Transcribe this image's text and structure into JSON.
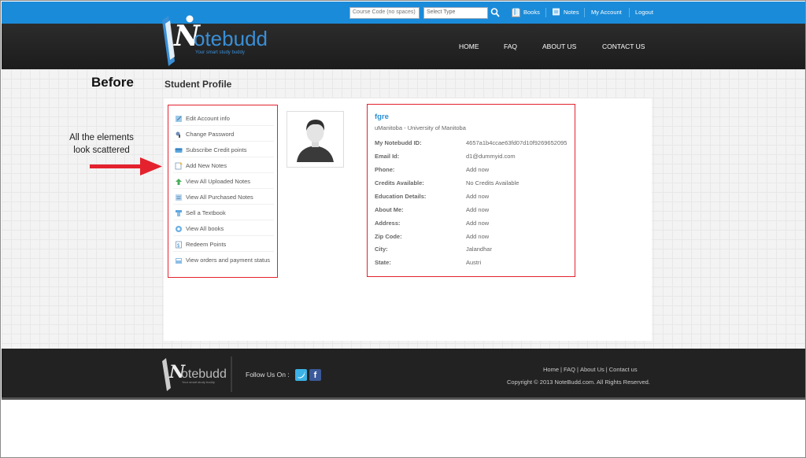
{
  "topbar": {
    "course_placeholder": "Course Code (no spaces)",
    "select_type": "Select Type",
    "links": [
      "Books",
      "Notes",
      "My Account",
      "Logout"
    ]
  },
  "header": {
    "logo_text": "Notebudd",
    "logo_tagline": "Your smart study buddy",
    "nav": [
      "HOME",
      "FAQ",
      "ABOUT US",
      "CONTACT US"
    ]
  },
  "annotation": {
    "before": "Before",
    "note": "All the elements look scattered"
  },
  "page": {
    "title": "Student Profile"
  },
  "menu": {
    "items": [
      {
        "label": "Edit Account info",
        "icon": "edit-icon"
      },
      {
        "label": "Change Password",
        "icon": "key-icon"
      },
      {
        "label": "Subscribe Credit points",
        "icon": "credit-icon"
      },
      {
        "label": "Add New Notes",
        "icon": "add-note-icon"
      },
      {
        "label": "View All Uploaded Notes",
        "icon": "upload-icon"
      },
      {
        "label": "View All Purchased Notes",
        "icon": "purchase-icon"
      },
      {
        "label": "Sell a Textbook",
        "icon": "sell-icon"
      },
      {
        "label": "View All books",
        "icon": "books-icon"
      },
      {
        "label": "Redeem Points",
        "icon": "redeem-icon"
      },
      {
        "label": "View orders and payment status",
        "icon": "orders-icon"
      }
    ]
  },
  "profile": {
    "name": "fgre",
    "university": "uManitoba - University of Manitoba",
    "fields": [
      {
        "key": "My Notebudd ID:",
        "value": "4657a1b4ccae63fd07d10f9269652095"
      },
      {
        "key": "Email Id:",
        "value": "d1@dummyid.com"
      },
      {
        "key": "Phone:",
        "value": "Add now"
      },
      {
        "key": "Credits Available:",
        "value": "No Credits Available"
      },
      {
        "key": "Education Details:",
        "value": "Add now"
      },
      {
        "key": "About Me:",
        "value": "Add now"
      },
      {
        "key": "Address:",
        "value": "Add now"
      },
      {
        "key": "Zip Code:",
        "value": "Add now"
      },
      {
        "key": "City:",
        "value": "Jalandhar"
      },
      {
        "key": "State:",
        "value": "Austri"
      }
    ]
  },
  "footer": {
    "follow": "Follow Us On :",
    "links": [
      "Home",
      "FAQ",
      "About Us",
      "Contact us"
    ],
    "copyright": "Copyright © 2013 NoteBudd.com. All Rights Reserved.",
    "logo_text": "Notebudd",
    "logo_tagline": "Your smart study buddy"
  },
  "colors": {
    "topbar": "#1a8bd9",
    "header": "#222222",
    "accent": "#2b8fd4",
    "highlight": "#e3222e"
  }
}
